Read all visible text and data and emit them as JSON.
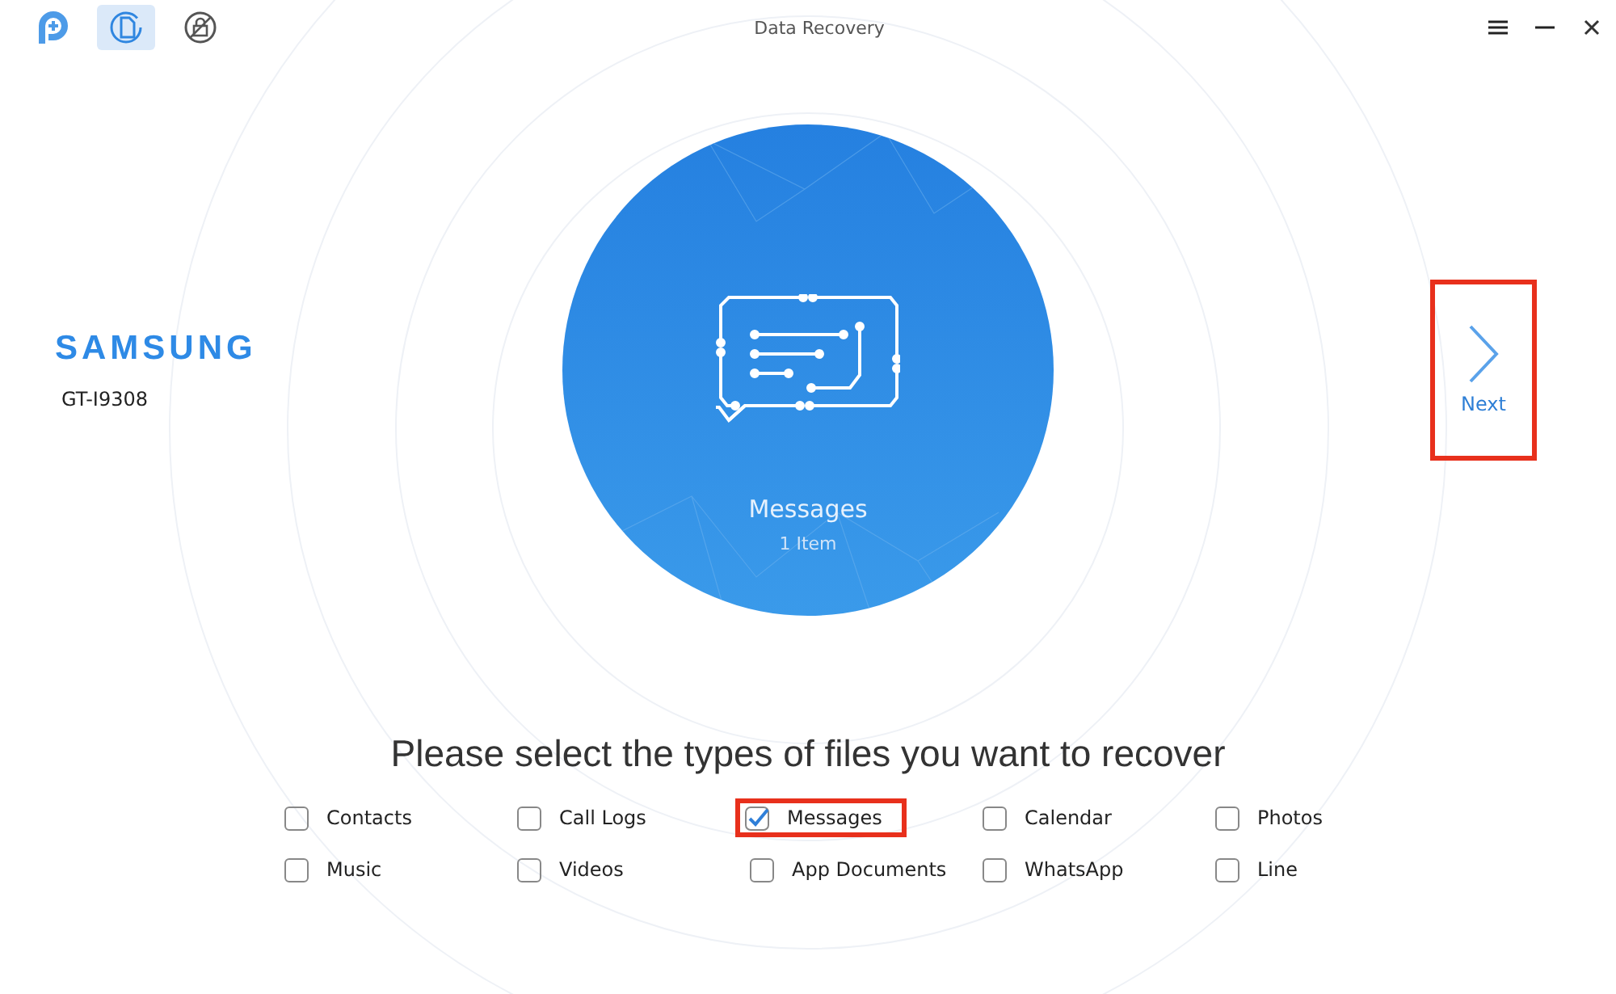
{
  "window": {
    "title": "Data Recovery"
  },
  "toolbar": [
    {
      "kind": "logo",
      "selected": false
    },
    {
      "kind": "recovery",
      "selected": true
    },
    {
      "kind": "unlock",
      "selected": false
    }
  ],
  "device": {
    "brand": "SAMSUNG",
    "model": "GT-I9308"
  },
  "preview": {
    "title": "Messages",
    "count": "1 Item"
  },
  "next": {
    "label": "Next",
    "highlighted": true
  },
  "prompt": "Please select the types of files you want to recover",
  "file_types": [
    {
      "label": "Contacts",
      "checked": false,
      "highlighted": false
    },
    {
      "label": "Call Logs",
      "checked": false,
      "highlighted": false
    },
    {
      "label": "Messages",
      "checked": true,
      "highlighted": true
    },
    {
      "label": "Calendar",
      "checked": false,
      "highlighted": false
    },
    {
      "label": "Photos",
      "checked": false,
      "highlighted": false
    },
    {
      "label": "Music",
      "checked": false,
      "highlighted": false
    },
    {
      "label": "Videos",
      "checked": false,
      "highlighted": false
    },
    {
      "label": "App Documents",
      "checked": false,
      "highlighted": false
    },
    {
      "label": "WhatsApp",
      "checked": false,
      "highlighted": false
    },
    {
      "label": "Line",
      "checked": false,
      "highlighted": false
    }
  ]
}
